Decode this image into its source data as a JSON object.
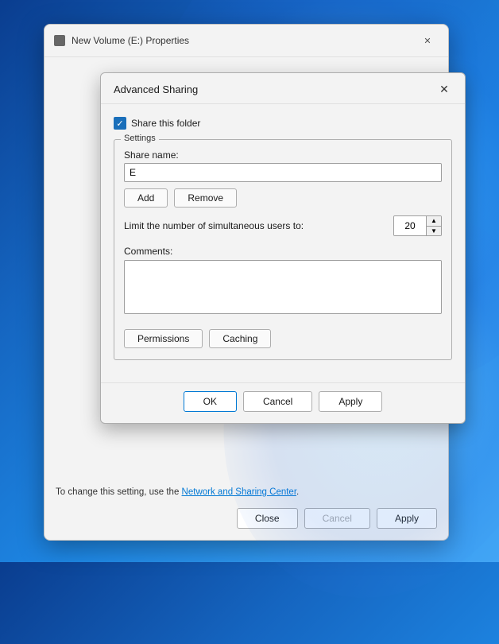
{
  "background": {
    "color": "#1565c0"
  },
  "properties_window": {
    "title": "New Volume (E:) Properties",
    "close_label": "✕"
  },
  "advanced_sharing_dialog": {
    "title": "Advanced Sharing",
    "close_label": "✕",
    "checkbox": {
      "label": "Share this folder",
      "checked": true
    },
    "settings_group": {
      "label": "Settings",
      "share_name_label": "Share name:",
      "share_name_value": "E",
      "add_button": "Add",
      "remove_button": "Remove",
      "limit_label": "Limit the number of simultaneous users to:",
      "limit_value": "20",
      "comments_label": "Comments:",
      "comments_value": "",
      "permissions_button": "Permissions",
      "caching_button": "Caching"
    },
    "footer": {
      "ok_label": "OK",
      "cancel_label": "Cancel",
      "apply_label": "Apply"
    }
  },
  "properties_footer": {
    "notice_text": "To change this setting, use the ",
    "notice_link": "Network and Sharing Center",
    "notice_suffix": ".",
    "close_label": "Close",
    "cancel_label": "Cancel",
    "apply_label": "Apply"
  }
}
